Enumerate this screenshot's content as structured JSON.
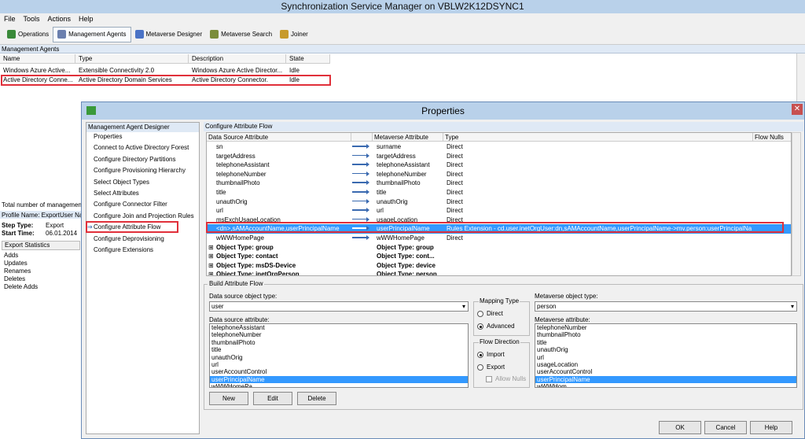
{
  "window": {
    "title": "Synchronization Service Manager on VBLW2K12DSYNC1"
  },
  "menu": [
    "File",
    "Tools",
    "Actions",
    "Help"
  ],
  "toolbar": [
    {
      "label": "Operations",
      "icon": "operations-icon"
    },
    {
      "label": "Management Agents",
      "icon": "agents-icon"
    },
    {
      "label": "Metaverse Designer",
      "icon": "designer-icon"
    },
    {
      "label": "Metaverse Search",
      "icon": "search-icon"
    },
    {
      "label": "Joiner",
      "icon": "joiner-icon"
    }
  ],
  "agents_section": {
    "title": "Management Agents",
    "columns": [
      "Name",
      "Type",
      "Description",
      "State"
    ],
    "rows": [
      [
        "Windows Azure Active...",
        "Extensible Connectivity 2.0",
        "Windows Azure Active Director...",
        "Idle"
      ],
      [
        "Active Directory Conne...",
        "Active Directory Domain Services",
        "Active Directory Connector.",
        "Idle"
      ]
    ]
  },
  "left_panel": {
    "total": "Total number of management",
    "profile_label": "Profile Name: Export",
    "user_label": "User Na",
    "step_type_label": "Step Type:",
    "step_type_value": "Export",
    "start_time_label": "Start Time:",
    "start_time_value": "06.01.2014",
    "export_stats": "Export Statistics",
    "stats": [
      "Adds",
      "Updates",
      "Renames",
      "Deletes",
      "Delete Adds"
    ]
  },
  "dialog": {
    "title": "Properties",
    "close": "✕",
    "nav_header": "Management Agent Designer",
    "nav_items": [
      "Properties",
      "Connect to Active Directory Forest",
      "Configure Directory Partitions",
      "Configure Provisioning Hierarchy",
      "Select Object Types",
      "Select Attributes",
      "Configure Connector Filter",
      "Configure Join and Projection Rules",
      "Configure Attribute Flow",
      "Configure Deprovisioning",
      "Configure Extensions"
    ],
    "selected_nav_arrow": "⇒",
    "caf_header": "Configure Attribute Flow",
    "grid_columns": [
      "Data Source Attribute",
      "",
      "Metaverse Attribute",
      "Type",
      "Flow Nulls"
    ],
    "grid_rows": [
      [
        "sn",
        "surname",
        "Direct"
      ],
      [
        "targetAddress",
        "targetAddress",
        "Direct"
      ],
      [
        "telephoneAssistant",
        "telephoneAssistant",
        "Direct"
      ],
      [
        "telephoneNumber",
        "telephoneNumber",
        "Direct"
      ],
      [
        "thumbnailPhoto",
        "thumbnailPhoto",
        "Direct"
      ],
      [
        "title",
        "title",
        "Direct"
      ],
      [
        "unauthOrig",
        "unauthOrig",
        "Direct"
      ],
      [
        "url",
        "url",
        "Direct"
      ],
      [
        "msExchUsageLocation",
        "usageLocation",
        "Direct"
      ],
      [
        "<dn>,sAMAccountName,userPrincipalName",
        "userPrincipalName",
        "Rules Extension - cd.user.inetOrgUser:dn,sAMAccountName,userPrincipalName->mv.person:userPrincipalName"
      ],
      [
        "wWWHomePage",
        "wWWHomePage",
        "Direct"
      ]
    ],
    "groups": [
      [
        "Object Type: group",
        "Object Type: group"
      ],
      [
        "Object Type: contact",
        "Object Type: cont..."
      ],
      [
        "Object Type: msDS-Device",
        "Object Type: device"
      ],
      [
        "Object Type: inetOrgPerson",
        "Object Type: person"
      ]
    ],
    "build": {
      "title": "Build Attribute Flow",
      "ds_type_label": "Data source object type:",
      "ds_type_value": "user",
      "ds_attr_label": "Data source attribute:",
      "ds_attrs": [
        "telephoneAssistant",
        "telephoneNumber",
        "thumbnailPhoto",
        "title",
        "unauthOrig",
        "url",
        "userAccountControl",
        "userPrincipalName",
        "wWWHomePa"
      ],
      "mapping_type": "Mapping Type",
      "direct": "Direct",
      "advanced": "Advanced",
      "flow_direction": "Flow Direction",
      "import": "Import",
      "export": "Export",
      "allow_nulls": "Allow Nulls",
      "mv_type_label": "Metaverse object type:",
      "mv_type_value": "person",
      "mv_attr_label": "Metaverse attribute:",
      "mv_attrs": [
        "telephoneNumber",
        "thumbnailPhoto",
        "title",
        "unauthOrig",
        "url",
        "usageLocation",
        "userAccountControl",
        "userPrincipalName",
        "wWWHom"
      ],
      "new": "New",
      "edit": "Edit",
      "delete": "Delete"
    },
    "ok": "OK",
    "cancel": "Cancel",
    "help": "Help"
  },
  "colors": {
    "title_bar": "#b9d1ea",
    "selection": "#3399ff",
    "highlight_box": "#e0303a"
  }
}
